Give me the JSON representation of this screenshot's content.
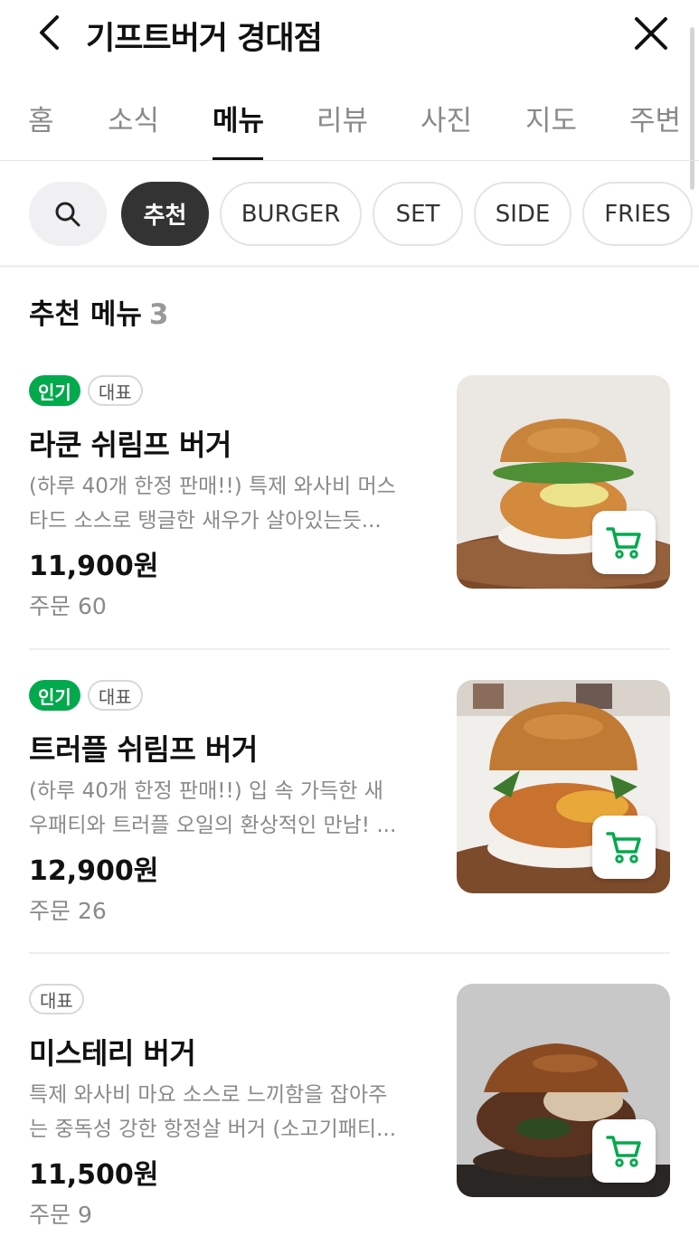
{
  "header": {
    "title": "기프트버거 경대점",
    "back_icon": "chevron-left-icon",
    "close_icon": "close-icon"
  },
  "tabs": [
    {
      "label": "홈",
      "active": false
    },
    {
      "label": "소식",
      "active": false
    },
    {
      "label": "메뉴",
      "active": true
    },
    {
      "label": "리뷰",
      "active": false
    },
    {
      "label": "사진",
      "active": false
    },
    {
      "label": "지도",
      "active": false
    },
    {
      "label": "주변",
      "active": false
    }
  ],
  "filters": {
    "search_icon": "search-icon",
    "chips": [
      {
        "label": "추천",
        "active": true
      },
      {
        "label": "BURGER",
        "active": false
      },
      {
        "label": "SET",
        "active": false
      },
      {
        "label": "SIDE",
        "active": false
      },
      {
        "label": "FRIES",
        "active": false
      }
    ]
  },
  "section": {
    "title": "추천 메뉴",
    "count": "3"
  },
  "menu_items": [
    {
      "badges": [
        "인기",
        "대표"
      ],
      "name": "라쿤 쉬림프 버거",
      "desc_line1": "(하루 40개 한정 판매!!) 특제 와사비 머스",
      "desc_line2": "타드 소스로 탱글한 새우가 살아있는듯...",
      "price": "11,900원",
      "orders": "주문 60"
    },
    {
      "badges": [
        "인기",
        "대표"
      ],
      "name": "트러플 쉬림프 버거",
      "desc_line1": "(하루 40개 한정 판매!!) 입 속 가득한 새",
      "desc_line2": "우패티와 트러플 오일의 환상적인 만남! ...",
      "price": "12,900원",
      "orders": "주문 26"
    },
    {
      "badges": [
        "대표"
      ],
      "name": "미스테리 버거",
      "desc_line1": "특제 와사비 마요 소스로 느끼함을 잡아주",
      "desc_line2": "는 중독성 강한 항정살 버거 (소고기패티...",
      "price": "11,500원",
      "orders": "주문 9"
    }
  ],
  "colors": {
    "accent_green": "#03a94d",
    "active_chip": "#333333",
    "muted_text": "#8a8a8a"
  }
}
